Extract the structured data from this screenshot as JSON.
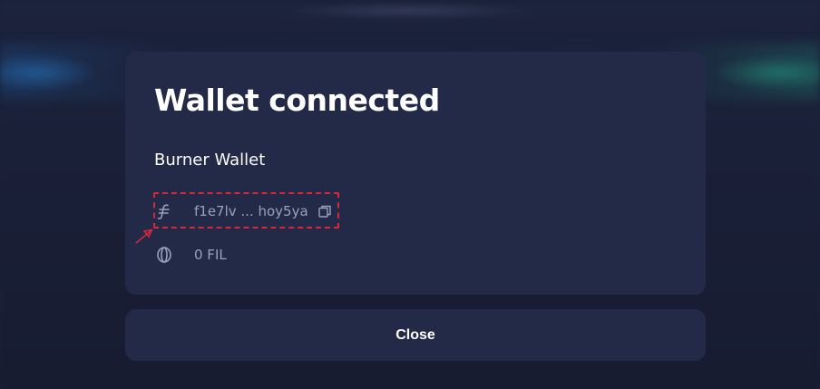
{
  "modal": {
    "title": "Wallet connected",
    "wallet_name": "Burner Wallet",
    "address": "f1e7lv ... hoy5ya",
    "balance": "0 FIL",
    "icons": {
      "address": "filecoin-icon",
      "copy": "copy-icon",
      "balance": "coin-icon"
    }
  },
  "close_label": "Close",
  "colors": {
    "background": "#1a2038",
    "card": "#222a48",
    "muted_text": "#9aa1bd",
    "highlight": "#d8283a"
  }
}
